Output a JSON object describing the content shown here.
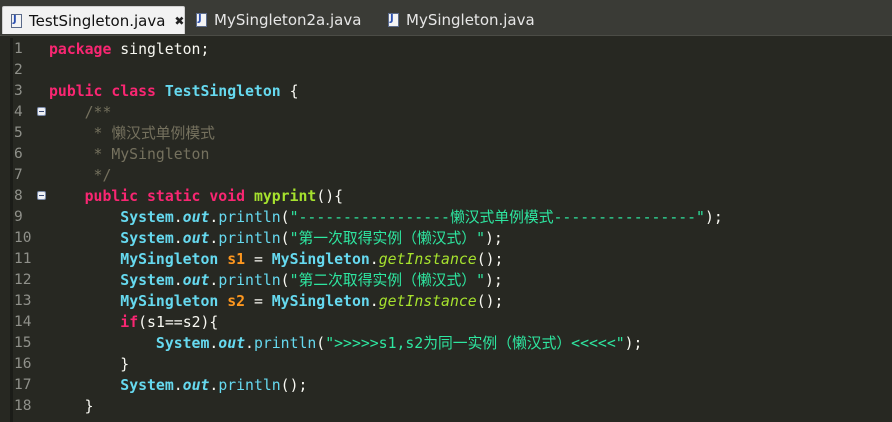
{
  "tabs": [
    {
      "label": "TestSingleton.java",
      "active": true,
      "close": "✖"
    },
    {
      "label": "MySingleton2a.java",
      "active": false
    },
    {
      "label": "MySingleton.java",
      "active": false
    }
  ],
  "colors": {
    "background": "#272822",
    "keyword": "#f92672",
    "type": "#66d9ef",
    "method": "#a6e22e",
    "string": "#2ee6a0",
    "comment": "#75715e",
    "variable": "#fd971f"
  },
  "lines": [
    {
      "num": "1",
      "fold": false,
      "tokens": [
        [
          "kw",
          "package"
        ],
        [
          "plain",
          " singleton;"
        ]
      ]
    },
    {
      "num": "2",
      "fold": false,
      "tokens": []
    },
    {
      "num": "3",
      "fold": false,
      "tokens": [
        [
          "kw",
          "public"
        ],
        [
          "plain",
          " "
        ],
        [
          "kw",
          "class"
        ],
        [
          "plain",
          " "
        ],
        [
          "cls",
          "TestSingleton"
        ],
        [
          "plain",
          " {"
        ]
      ]
    },
    {
      "num": "4",
      "fold": true,
      "tokens": [
        [
          "plain",
          "    "
        ],
        [
          "comment",
          "/**"
        ]
      ]
    },
    {
      "num": "5",
      "fold": false,
      "tokens": [
        [
          "plain",
          "     "
        ],
        [
          "comment",
          "* 懒汉式单例模式"
        ]
      ]
    },
    {
      "num": "6",
      "fold": false,
      "tokens": [
        [
          "plain",
          "     "
        ],
        [
          "comment",
          "* MySingleton"
        ]
      ]
    },
    {
      "num": "7",
      "fold": false,
      "tokens": [
        [
          "plain",
          "     "
        ],
        [
          "comment",
          "*/"
        ]
      ]
    },
    {
      "num": "8",
      "fold": true,
      "tokens": [
        [
          "plain",
          "    "
        ],
        [
          "kw",
          "public"
        ],
        [
          "plain",
          " "
        ],
        [
          "kw",
          "static"
        ],
        [
          "plain",
          " "
        ],
        [
          "kw",
          "void"
        ],
        [
          "plain",
          " "
        ],
        [
          "method",
          "myprint"
        ],
        [
          "plain",
          "(){"
        ]
      ]
    },
    {
      "num": "9",
      "fold": false,
      "tokens": [
        [
          "plain",
          "        "
        ],
        [
          "type",
          "System"
        ],
        [
          "plain",
          "."
        ],
        [
          "field",
          "out"
        ],
        [
          "plain",
          "."
        ],
        [
          "call",
          "println"
        ],
        [
          "plain",
          "("
        ],
        [
          "str",
          "\"-----------------懒汉式单例模式----------------\""
        ],
        [
          "plain",
          ");"
        ]
      ]
    },
    {
      "num": "10",
      "fold": false,
      "tokens": [
        [
          "plain",
          "        "
        ],
        [
          "type",
          "System"
        ],
        [
          "plain",
          "."
        ],
        [
          "field",
          "out"
        ],
        [
          "plain",
          "."
        ],
        [
          "call",
          "println"
        ],
        [
          "plain",
          "("
        ],
        [
          "str",
          "\"第一次取得实例（懒汉式）\""
        ],
        [
          "plain",
          ");"
        ]
      ]
    },
    {
      "num": "11",
      "fold": false,
      "tokens": [
        [
          "plain",
          "        "
        ],
        [
          "type",
          "MySingleton"
        ],
        [
          "plain",
          " "
        ],
        [
          "var",
          "s1"
        ],
        [
          "plain",
          " = "
        ],
        [
          "type",
          "MySingleton"
        ],
        [
          "plain",
          "."
        ],
        [
          "static-call",
          "getInstance"
        ],
        [
          "plain",
          "();"
        ]
      ]
    },
    {
      "num": "12",
      "fold": false,
      "tokens": [
        [
          "plain",
          "        "
        ],
        [
          "type",
          "System"
        ],
        [
          "plain",
          "."
        ],
        [
          "field",
          "out"
        ],
        [
          "plain",
          "."
        ],
        [
          "call",
          "println"
        ],
        [
          "plain",
          "("
        ],
        [
          "str",
          "\"第二次取得实例（懒汉式）\""
        ],
        [
          "plain",
          ");"
        ]
      ]
    },
    {
      "num": "13",
      "fold": false,
      "tokens": [
        [
          "plain",
          "        "
        ],
        [
          "type",
          "MySingleton"
        ],
        [
          "plain",
          " "
        ],
        [
          "var",
          "s2"
        ],
        [
          "plain",
          " = "
        ],
        [
          "type",
          "MySingleton"
        ],
        [
          "plain",
          "."
        ],
        [
          "static-call",
          "getInstance"
        ],
        [
          "plain",
          "();"
        ]
      ]
    },
    {
      "num": "14",
      "fold": false,
      "tokens": [
        [
          "plain",
          "        "
        ],
        [
          "kw",
          "if"
        ],
        [
          "plain",
          "("
        ],
        [
          "local",
          "s1"
        ],
        [
          "plain",
          "=="
        ],
        [
          "local",
          "s2"
        ],
        [
          "plain",
          "){"
        ]
      ]
    },
    {
      "num": "15",
      "fold": false,
      "tokens": [
        [
          "plain",
          "            "
        ],
        [
          "type",
          "System"
        ],
        [
          "plain",
          "."
        ],
        [
          "field",
          "out"
        ],
        [
          "plain",
          "."
        ],
        [
          "call",
          "println"
        ],
        [
          "plain",
          "("
        ],
        [
          "str",
          "\">>>>>s1,s2为同一实例（懒汉式）<<<<<\""
        ],
        [
          "plain",
          ");"
        ]
      ]
    },
    {
      "num": "16",
      "fold": false,
      "tokens": [
        [
          "plain",
          "        }"
        ]
      ]
    },
    {
      "num": "17",
      "fold": false,
      "tokens": [
        [
          "plain",
          "        "
        ],
        [
          "type",
          "System"
        ],
        [
          "plain",
          "."
        ],
        [
          "field",
          "out"
        ],
        [
          "plain",
          "."
        ],
        [
          "call",
          "println"
        ],
        [
          "plain",
          "();"
        ]
      ]
    },
    {
      "num": "18",
      "fold": false,
      "tokens": [
        [
          "plain",
          "    }"
        ]
      ]
    }
  ]
}
